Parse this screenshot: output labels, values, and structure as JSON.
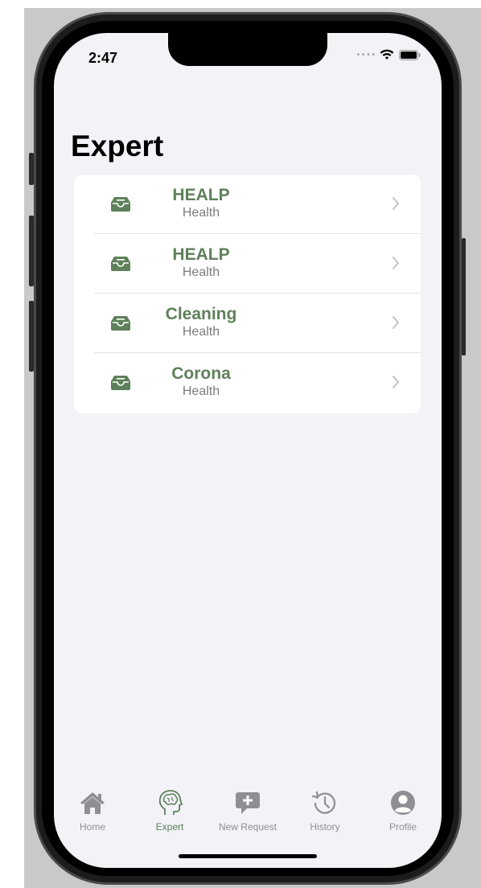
{
  "status_bar": {
    "time": "2:47"
  },
  "page": {
    "title": "Expert"
  },
  "experts": [
    {
      "title": "HEALP",
      "subtitle": "Health",
      "icon": "tray-icon"
    },
    {
      "title": "HEALP",
      "subtitle": "Health",
      "icon": "tray-icon"
    },
    {
      "title": "Cleaning",
      "subtitle": "Health",
      "icon": "tray-icon"
    },
    {
      "title": "Corona",
      "subtitle": "Health",
      "icon": "tray-icon"
    }
  ],
  "tabbar": {
    "tabs": [
      {
        "label": "Home",
        "icon": "house-icon"
      },
      {
        "label": "Expert",
        "icon": "brain-head-icon",
        "active": true
      },
      {
        "label": "New Request",
        "icon": "plus-bubble-icon"
      },
      {
        "label": "History",
        "icon": "history-clock-icon"
      },
      {
        "label": "Profile",
        "icon": "person-circle-icon"
      }
    ]
  },
  "colors": {
    "accent": "#5e805a",
    "inactive": "#8e8e93",
    "background": "#f2f2f7",
    "card": "#ffffff"
  }
}
